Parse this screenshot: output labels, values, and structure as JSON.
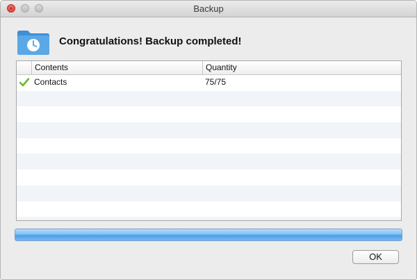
{
  "window": {
    "title": "Backup"
  },
  "header": {
    "icon": "folder-clock-icon",
    "message": "Congratulations! Backup completed!"
  },
  "table": {
    "columns": {
      "contents": "Contents",
      "quantity": "Quantity"
    },
    "rows": [
      {
        "status_icon": "checkmark-icon",
        "contents": "Contacts",
        "quantity": "75/75"
      }
    ],
    "total_visible_rows": 9
  },
  "progress": {
    "fraction": 1.0
  },
  "actions": {
    "ok_label": "OK"
  },
  "colors": {
    "accent": "#4d9ee9",
    "check": "#6ab82d",
    "folder": "#5aa8e6"
  }
}
